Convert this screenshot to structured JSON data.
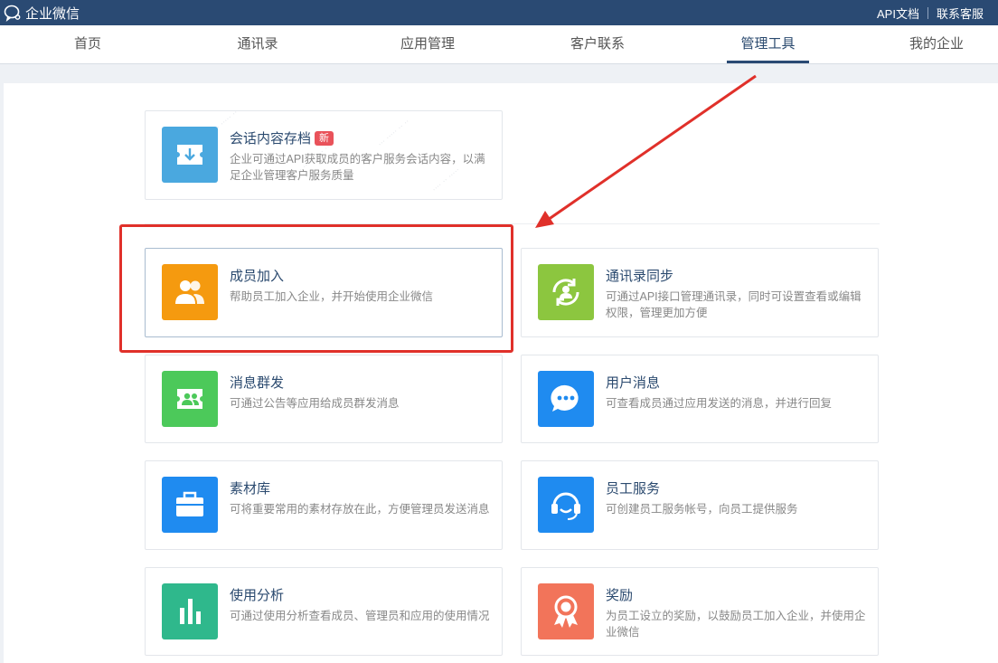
{
  "topbar": {
    "brand": "企业微信",
    "links": [
      "API文档",
      "联系客服"
    ]
  },
  "nav": {
    "items": [
      {
        "label": "首页",
        "active": false
      },
      {
        "label": "通讯录",
        "active": false
      },
      {
        "label": "应用管理",
        "active": false
      },
      {
        "label": "客户联系",
        "active": false
      },
      {
        "label": "管理工具",
        "active": true
      },
      {
        "label": "我的企业",
        "active": false
      }
    ]
  },
  "featured": {
    "title": "会话内容存档",
    "badge": "新",
    "desc": "企业可通过API获取成员的客户服务会话内容，以满足企业管理客户服务质量",
    "icon": "archive-download-icon",
    "color": "#4aa8df"
  },
  "tools": [
    {
      "title": "成员加入",
      "desc": "帮助员工加入企业，并开始使用企业微信",
      "icon": "members-icon",
      "color": "#f59a0f"
    },
    {
      "title": "通讯录同步",
      "desc": "可通过API接口管理通讯录，同时可设置查看或编辑权限，管理更加方便",
      "icon": "sync-contact-icon",
      "color": "#8cc63f"
    },
    {
      "title": "消息群发",
      "desc": "可通过公告等应用给成员群发消息",
      "icon": "broadcast-message-icon",
      "color": "#4cc95a"
    },
    {
      "title": "用户消息",
      "desc": "可查看成员通过应用发送的消息，并进行回复",
      "icon": "chat-bubble-icon",
      "color": "#1f8bf0"
    },
    {
      "title": "素材库",
      "desc": "可将重要常用的素材存放在此，方便管理员发送消息",
      "icon": "briefcase-icon",
      "color": "#1f8bf0"
    },
    {
      "title": "员工服务",
      "desc": "可创建员工服务帐号，向员工提供服务",
      "icon": "headset-icon",
      "color": "#1f8bf0"
    },
    {
      "title": "使用分析",
      "desc": "可通过使用分析查看成员、管理员和应用的使用情况",
      "icon": "bar-chart-icon",
      "color": "#2fb88c"
    },
    {
      "title": "奖励",
      "desc": "为员工设立的奖励，以鼓励员工加入企业，并使用企业微信",
      "icon": "award-medal-icon",
      "color": "#f2745a"
    }
  ]
}
